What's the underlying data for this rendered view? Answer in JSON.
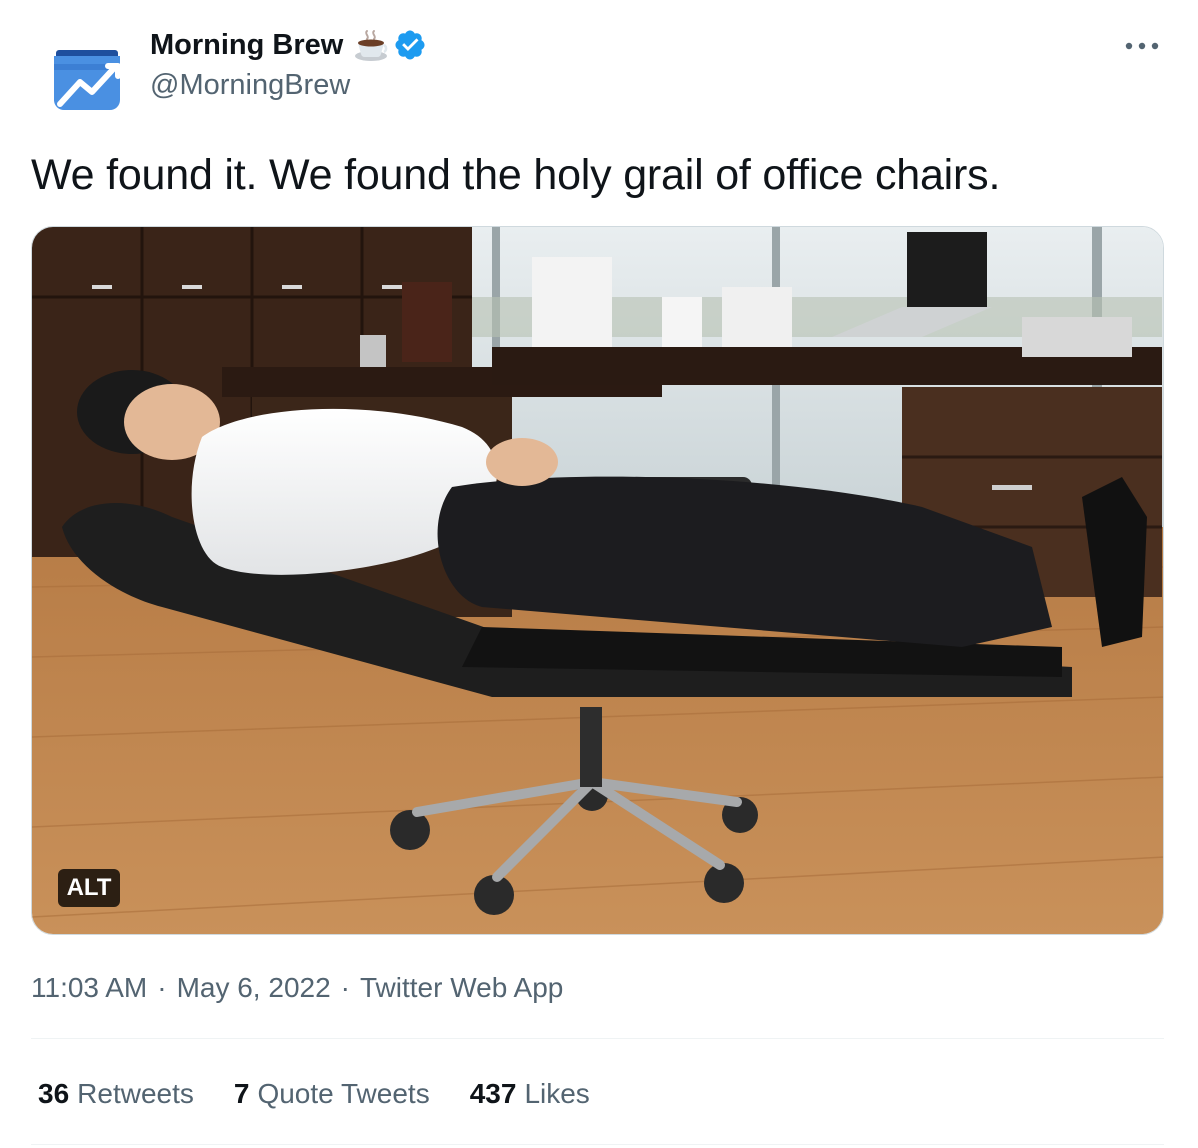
{
  "author": {
    "name": "Morning Brew",
    "handle": "@MorningBrew",
    "name_emoji": "coffee-icon",
    "verified": true,
    "brand_color": "#4a90e2"
  },
  "tweet": {
    "text": "We found it. We found the holy grail of office chairs.",
    "media_alt_badge": "ALT"
  },
  "meta": {
    "time": "11:03 AM",
    "separator": "·",
    "date": "May 6, 2022",
    "source": "Twitter Web App"
  },
  "stats": {
    "retweets_count": "36",
    "retweets_label": "Retweets",
    "quotes_count": "7",
    "quotes_label": "Quote Tweets",
    "likes_count": "437",
    "likes_label": "Likes"
  },
  "colors": {
    "text_primary": "#0f1419",
    "text_secondary": "#536471",
    "verified_blue": "#1d9bf0",
    "divider": "#eff3f4"
  }
}
